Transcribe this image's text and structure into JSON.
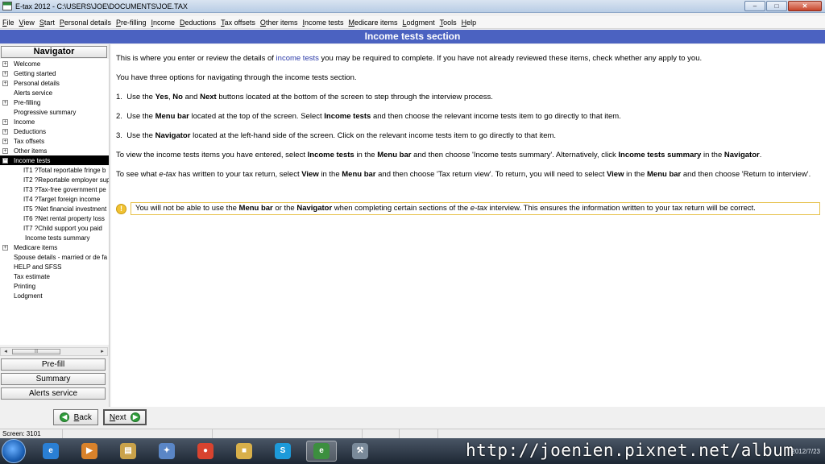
{
  "window": {
    "title": "E-tax 2012 - C:\\USERS\\JOE\\DOCUMENTS\\JOE.TAX",
    "minimize": "–",
    "maximize": "□",
    "close": "✕"
  },
  "menubar": {
    "items": [
      {
        "u": "F",
        "rest": "ile"
      },
      {
        "u": "V",
        "rest": "iew"
      },
      {
        "u": "S",
        "rest": "tart"
      },
      {
        "u": "P",
        "rest": "ersonal details"
      },
      {
        "u": "P",
        "rest": "re-filling"
      },
      {
        "u": "I",
        "rest": "ncome"
      },
      {
        "u": "D",
        "rest": "eductions"
      },
      {
        "u": "T",
        "rest": "ax offsets"
      },
      {
        "u": "O",
        "rest": "ther items"
      },
      {
        "u": "I",
        "rest": "ncome tests"
      },
      {
        "u": "M",
        "rest": "edicare items"
      },
      {
        "u": "L",
        "rest": "odgment"
      },
      {
        "u": "T",
        "rest": "ools"
      },
      {
        "u": "H",
        "rest": "elp"
      }
    ]
  },
  "section": {
    "title": "Income tests section"
  },
  "navigator": {
    "title": "Navigator",
    "items": [
      {
        "label": "Welcome",
        "expander": "+"
      },
      {
        "label": "Getting started",
        "expander": "+"
      },
      {
        "label": "Personal details",
        "expander": "+"
      },
      {
        "label": "Alerts service",
        "expander": ""
      },
      {
        "label": "Pre-filling",
        "expander": "+"
      },
      {
        "label": "Progressive summary",
        "expander": ""
      },
      {
        "label": "Income",
        "expander": "+"
      },
      {
        "label": "Deductions",
        "expander": "+"
      },
      {
        "label": "Tax offsets",
        "expander": "+"
      },
      {
        "label": "Other items",
        "expander": "+"
      },
      {
        "label": "Income tests",
        "expander": "−",
        "selected": true
      },
      {
        "label": "IT1 ?Total reportable fringe b",
        "child": true
      },
      {
        "label": "IT2 ?Reportable employer sup",
        "child": true
      },
      {
        "label": "IT3 ?Tax-free government pe",
        "child": true
      },
      {
        "label": "IT4 ?Target foreign income",
        "child": true
      },
      {
        "label": "IT5 ?Net financial investment",
        "child": true
      },
      {
        "label": "IT6 ?Net rental property loss",
        "child": true
      },
      {
        "label": "IT7 ?Child support you paid",
        "child": true
      },
      {
        "label": "Income tests summary",
        "child2": true
      },
      {
        "label": "Medicare items",
        "expander": "+"
      },
      {
        "label": "Spouse details - married or de fa",
        "expander": ""
      },
      {
        "label": "HELP and SFSS",
        "expander": ""
      },
      {
        "label": "Tax estimate",
        "expander": ""
      },
      {
        "label": "Printing",
        "expander": ""
      },
      {
        "label": "Lodgment",
        "expander": ""
      }
    ],
    "scroll_left": "◂",
    "scroll_right": "▸",
    "scroll_grip": "|||",
    "buttons": {
      "prefill": "Pre-fill",
      "summary": "Summary",
      "alerts": "Alerts service"
    }
  },
  "content": {
    "p1_a": "This is where you enter or review the details of ",
    "p1_link": "income tests",
    "p1_b": " you may be required to complete. If you have not already reviewed these items, check whether any apply to you.",
    "p2": "You have three options for navigating through the income tests section.",
    "p3": {
      "num": "1.",
      "a": "Use the ",
      "yes": "Yes",
      "comma": ", ",
      "no": "No",
      "and": " and ",
      "next": "Next",
      "b": " buttons located at the bottom of the screen to step through the interview process."
    },
    "p4": {
      "num": "2.",
      "a": "Use the ",
      "menubar": "Menu bar",
      "b": " located at the top of the screen. Select ",
      "it": "Income tests",
      "c": " and then choose the relevant income tests item to go directly to that item."
    },
    "p5": {
      "num": "3.",
      "a": "Use the ",
      "nav": "Navigator",
      "b": " located at the left-hand side of the screen. Click on the relevant income tests item to go directly to that item."
    },
    "p6": {
      "a": "To view the income tests items you have entered, select ",
      "it": "Income tests",
      "b": " in the ",
      "mb": "Menu bar",
      "c": " and then choose 'Income tests summary'. Alternatively, click ",
      "its": "Income tests summary",
      "d": " in the ",
      "nav": "Navigator",
      "e": "."
    },
    "p7": {
      "a": "To see what ",
      "etax": "e-tax",
      "b": " has written to your tax return, select ",
      "view": "View",
      "c": " in the ",
      "mb": "Menu bar",
      "d": " and then choose 'Tax return view'. To return, you will need to select ",
      "view2": "View",
      "e": " in the ",
      "mb2": "Menu bar",
      "f": " and then choose 'Return to interview'."
    },
    "note": {
      "icon": "!",
      "a": "You will not be able to use the ",
      "mb": "Menu bar",
      "b": " or the ",
      "nav": "Navigator",
      "c": " when completing certain sections of the ",
      "etax": "e-tax",
      "d": " interview. This ensures the information written to your tax return will be correct."
    }
  },
  "bottom": {
    "back_u": "B",
    "back_rest": "ack",
    "back_icon": "◀",
    "next_u": "N",
    "next_rest": "ext",
    "next_icon": "▶"
  },
  "status": {
    "screen": "Screen: 3101"
  },
  "taskbar": {
    "apps": [
      {
        "name": "ie-icon",
        "glyph": "e",
        "color": "#2a7fd4"
      },
      {
        "name": "media-player-icon",
        "glyph": "▶",
        "color": "#d9822b"
      },
      {
        "name": "explorer-icon",
        "glyph": "▤",
        "color": "#c9a24a"
      },
      {
        "name": "app-icon",
        "glyph": "✦",
        "color": "#5a86c6"
      },
      {
        "name": "chrome-icon",
        "glyph": "●",
        "color": "#d8432f"
      },
      {
        "name": "folder-icon",
        "glyph": "■",
        "color": "#d8b04a"
      },
      {
        "name": "skype-icon",
        "glyph": "S",
        "color": "#1d9ad9"
      },
      {
        "name": "etax-icon",
        "glyph": "e",
        "color": "#3c8f3f",
        "active": true
      },
      {
        "name": "tool-icon",
        "glyph": "⚒",
        "color": "#7a8a9a"
      }
    ],
    "watermark": "http://joenien.pixnet.net/album",
    "clock": "2012/7/23"
  }
}
